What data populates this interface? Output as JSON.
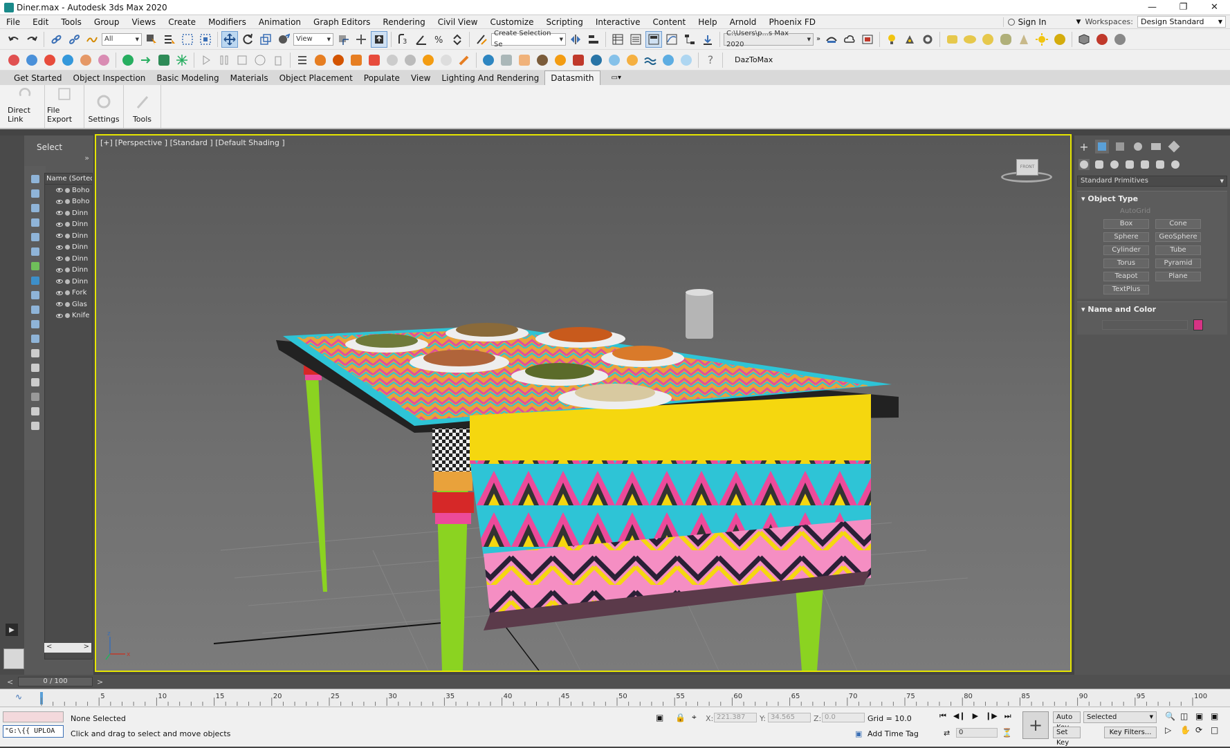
{
  "window": {
    "title": "Diner.max - Autodesk 3ds Max 2020"
  },
  "menu": [
    "File",
    "Edit",
    "Tools",
    "Group",
    "Views",
    "Create",
    "Modifiers",
    "Animation",
    "Graph Editors",
    "Rendering",
    "Civil View",
    "Customize",
    "Scripting",
    "Interactive",
    "Content",
    "Help",
    "Arnold",
    "Phoenix FD"
  ],
  "account": {
    "sign_in": "Sign In",
    "workspaces_label": "Workspaces:",
    "workspace": "Design Standard"
  },
  "toolbar": {
    "filter": "All",
    "ref_coord": "View",
    "selection_set": "Create Selection Se",
    "project_path": "C:\\Users\\p...s Max 2020",
    "daz_label": "DazToMax"
  },
  "ribbon_tabs": [
    "Get Started",
    "Object Inspection",
    "Basic Modeling",
    "Materials",
    "Object Placement",
    "Populate",
    "View",
    "Lighting And Rendering",
    "Datasmith"
  ],
  "ribbon_tab_active": "Datasmith",
  "ribbon_groups": [
    "Direct Link",
    "File Export",
    "Settings",
    "Tools"
  ],
  "scene_explorer": {
    "select_label": "Select",
    "header": "Name (Sorted A",
    "rows": [
      "Boho",
      "Boho",
      "Dinn",
      "Dinn",
      "Dinn",
      "Dinn",
      "Dinn",
      "Dinn",
      "Dinn",
      "Fork",
      "Glas",
      "Knife"
    ]
  },
  "viewport": {
    "label": "[+] [Perspective ] [Standard ] [Default Shading ]",
    "viewcube_face": "FRONT"
  },
  "command_panel": {
    "category": "Standard Primitives",
    "object_type_title": "Object Type",
    "autogrid": "AutoGrid",
    "primitives": [
      "Box",
      "Cone",
      "Sphere",
      "GeoSphere",
      "Cylinder",
      "Tube",
      "Torus",
      "Pyramid",
      "Teapot",
      "Plane",
      "TextPlus"
    ],
    "name_color_title": "Name and Color",
    "object_color": "#d63384"
  },
  "time": {
    "slider_text": "0 / 100",
    "ticks": [
      "5",
      "10",
      "15",
      "20",
      "25",
      "30",
      "35",
      "40",
      "45",
      "50",
      "55",
      "60",
      "65",
      "70",
      "75",
      "80",
      "85",
      "90",
      "95",
      "100"
    ],
    "frame_field": "0"
  },
  "status": {
    "selection": "None Selected",
    "prompt": "Click and drag to select and move objects",
    "maxscript": "\"G:\\{{ UPLOA",
    "x_label": "X:",
    "x_value": "221.387",
    "y_label": "Y:",
    "y_value": "34.565",
    "z_label": "Z:",
    "z_value": "0.0",
    "grid": "Grid = 10.0",
    "add_time_tag": "Add Time Tag",
    "auto_key": "Auto Key",
    "set_key": "Set Key",
    "key_mode": "Selected",
    "key_filters": "Key Filters..."
  },
  "colors": {
    "viewport_border": "#e6e600",
    "tablecloth_pink": "#ec4a9a",
    "tablecloth_cyan": "#2ec4d6",
    "tablecloth_yellow": "#f5d70f",
    "legs": "#8bd321"
  }
}
